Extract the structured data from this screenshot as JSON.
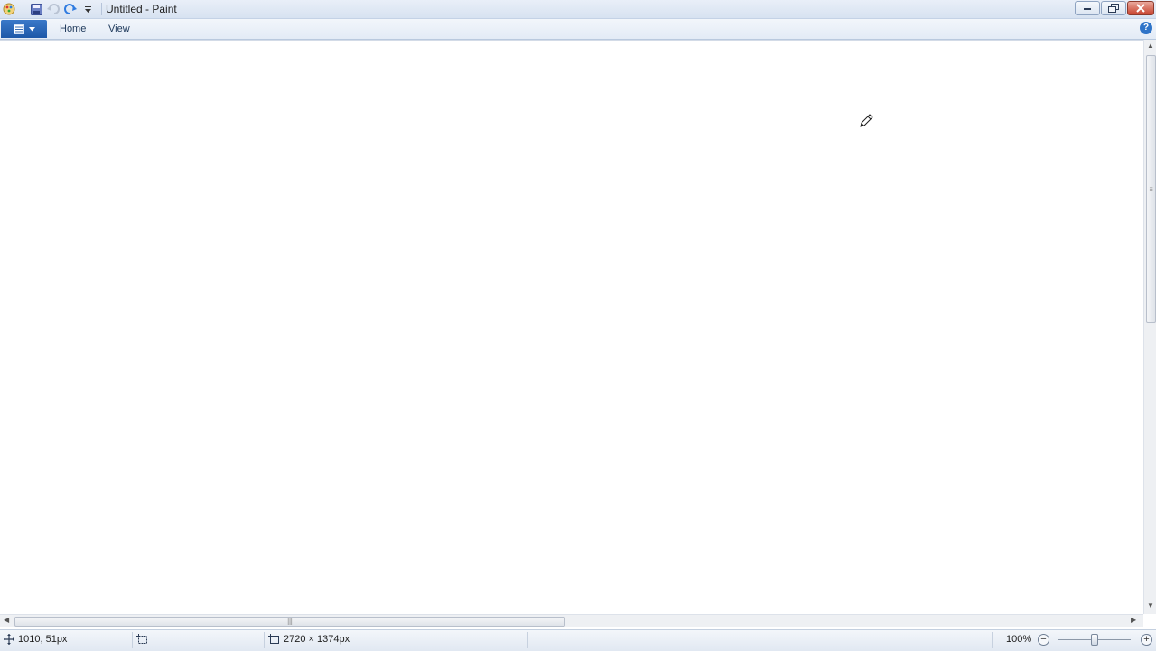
{
  "window": {
    "title": "Untitled - Paint",
    "icons": [
      "paint-app-icon",
      "save-icon",
      "undo-icon",
      "redo-icon",
      "customize-dropdown-icon"
    ]
  },
  "ribbon": {
    "tabs": [
      {
        "label": "Home"
      },
      {
        "label": "View"
      }
    ],
    "help_label": "?"
  },
  "status": {
    "cursor_position": "1010, 51px",
    "selection_size": "",
    "canvas_size": "2720 × 1374px",
    "zoom": "100%",
    "zoom_fraction": 0.5
  },
  "colors": {
    "accent": "#1d58a8",
    "close_button": "#c8432e",
    "canvas": "#ffffff"
  }
}
